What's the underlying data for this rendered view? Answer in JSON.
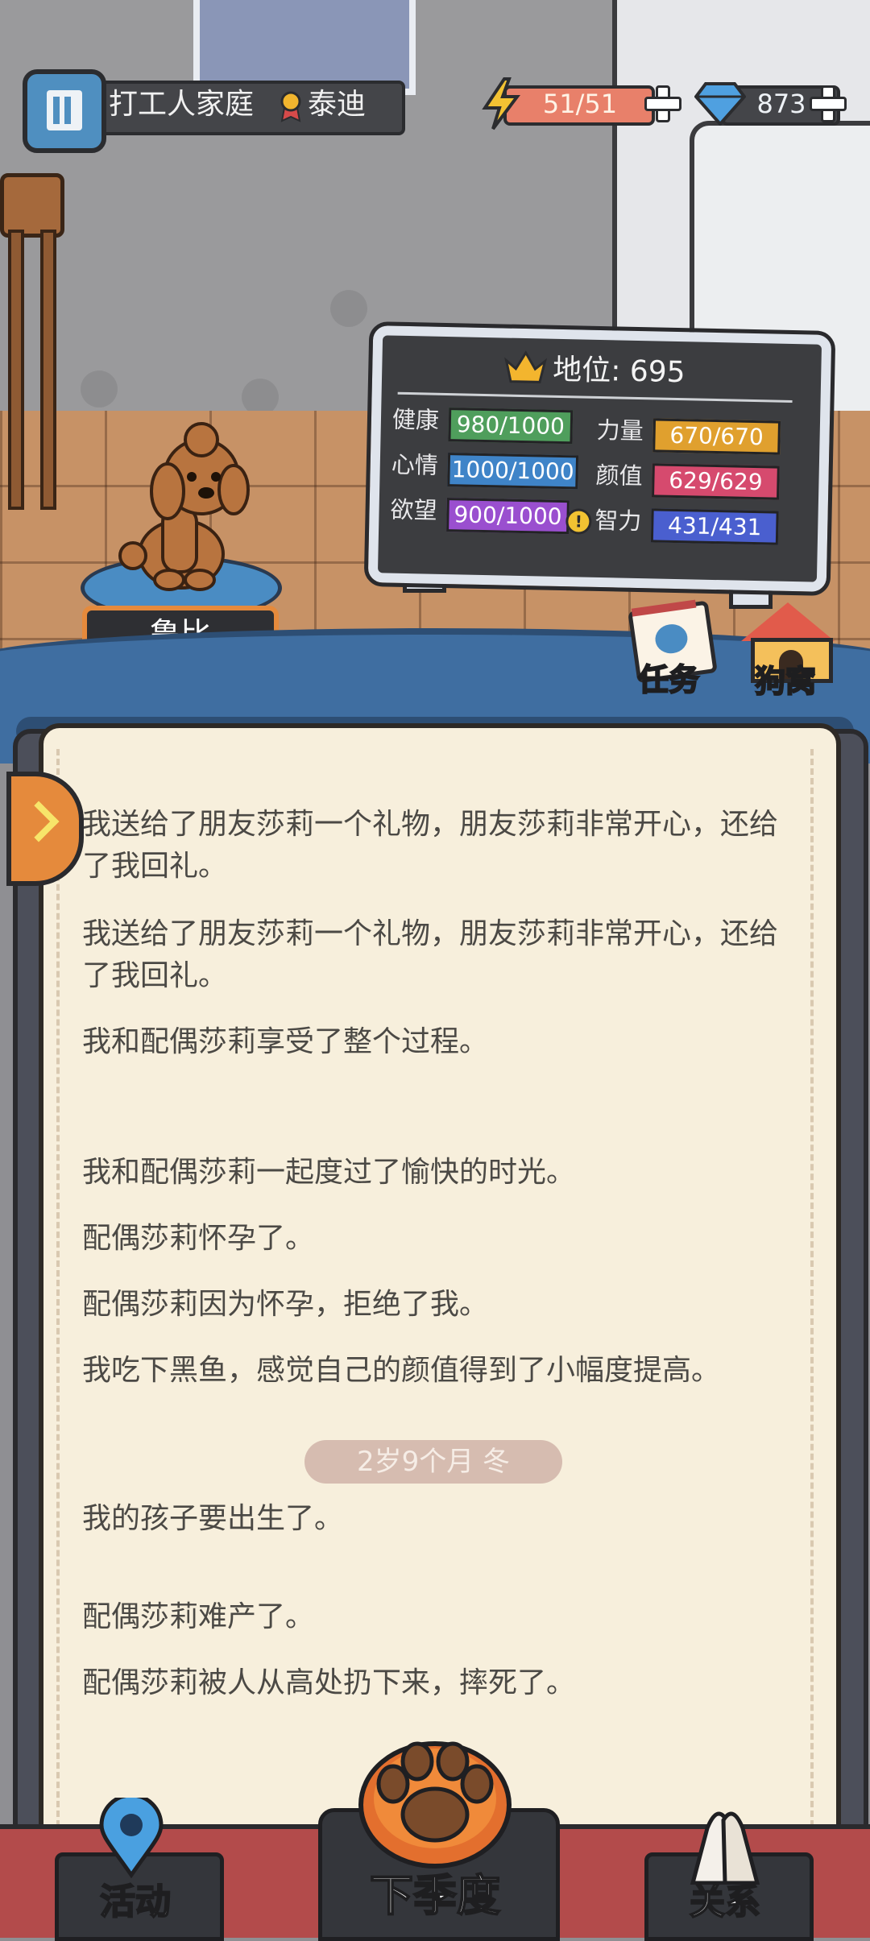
{
  "hud": {
    "family_name": "打工人家庭",
    "pet_tag": "泰迪",
    "energy": "51/51",
    "gems": "873"
  },
  "status": {
    "title": "地位: 695",
    "stats": [
      {
        "label": "健康",
        "value": "980/1000",
        "color": "#4f9e5c"
      },
      {
        "label": "心情",
        "value": "1000/1000",
        "color": "#3f84c8"
      },
      {
        "label": "欲望",
        "value": "900/1000",
        "color": "#9a4fcf"
      },
      {
        "label": "力量",
        "value": "670/670",
        "color": "#e0a02e"
      },
      {
        "label": "颜值",
        "value": "629/629",
        "color": "#d64a6e"
      },
      {
        "label": "智力",
        "value": "431/431",
        "color": "#4a5fcf"
      }
    ]
  },
  "pet": {
    "name": "鲁比"
  },
  "actions": {
    "task": "任务",
    "kennel": "狗窝"
  },
  "log": {
    "lines": [
      "我送给了朋友莎莉一个礼物，朋友莎莉非常开心，还给了我回礼。",
      "我送给了朋友莎莉一个礼物，朋友莎莉非常开心，还给了我回礼。",
      "我和配偶莎莉享受了整个过程。",
      "我和配偶莎莉一起度过了愉快的时光。",
      "配偶莎莉怀孕了。",
      "配偶莎莉因为怀孕，拒绝了我。",
      "我吃下黑鱼，感觉自己的颜值得到了小幅度提高。",
      "我的孩子要出生了。",
      "配偶莎莉难产了。",
      "配偶莎莉被人从高处扔下来，摔死了。"
    ],
    "season_divider": "2岁9个月 冬"
  },
  "bottom_nav": {
    "activity": "活动",
    "next_season": "下季度",
    "relation": "关系"
  },
  "icons": [
    "building-icon",
    "medal-icon",
    "lightning-icon",
    "diamond-icon",
    "plus-icon",
    "crown-icon",
    "paw-icon",
    "doghouse-icon",
    "map-pin-icon",
    "holding-hands-icon",
    "chevron-right-icon"
  ]
}
